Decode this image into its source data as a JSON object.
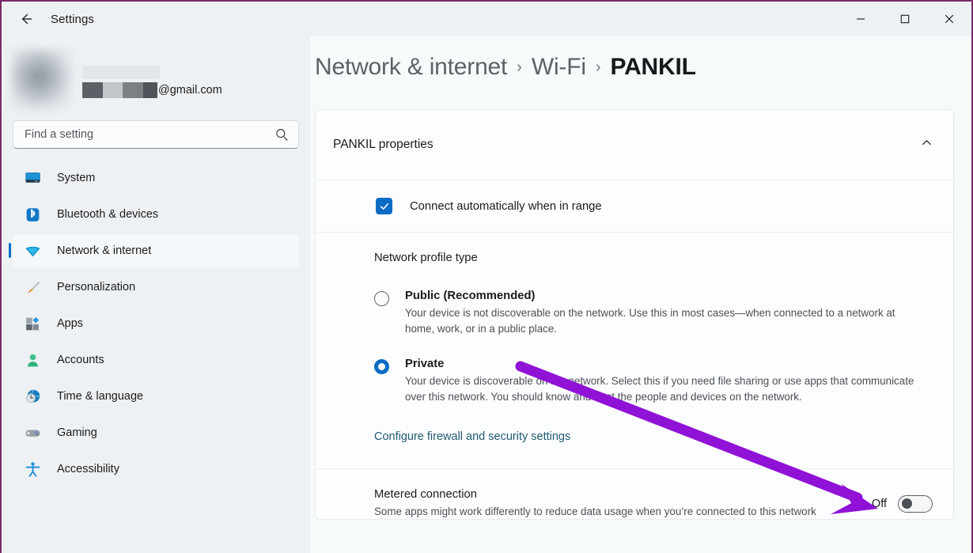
{
  "window": {
    "title": "Settings",
    "back_icon": "back-arrow-icon",
    "minimize_label": "–",
    "maximize_label": "□",
    "close_label": "✕"
  },
  "sidebar": {
    "account": {
      "email_domain": "@gmail.com",
      "name_redacted": true
    },
    "search": {
      "placeholder": "Find a setting",
      "value": "",
      "icon": "search-icon"
    },
    "items": [
      {
        "label": "System",
        "icon": "monitor-icon",
        "selected": false
      },
      {
        "label": "Bluetooth & devices",
        "icon": "bluetooth-icon",
        "selected": false
      },
      {
        "label": "Network & internet",
        "icon": "wifi-icon",
        "selected": true
      },
      {
        "label": "Personalization",
        "icon": "paintbrush-icon",
        "selected": false
      },
      {
        "label": "Apps",
        "icon": "apps-icon",
        "selected": false
      },
      {
        "label": "Accounts",
        "icon": "person-icon",
        "selected": false
      },
      {
        "label": "Time & language",
        "icon": "clock-globe-icon",
        "selected": false
      },
      {
        "label": "Gaming",
        "icon": "gamepad-icon",
        "selected": false
      },
      {
        "label": "Accessibility",
        "icon": "accessibility-icon",
        "selected": false
      }
    ]
  },
  "breadcrumb": {
    "items": [
      "Network & internet",
      "Wi-Fi",
      "PANKIL"
    ],
    "separator": "›"
  },
  "card": {
    "title": "PANKIL properties",
    "collapse_icon": "chevron-up-icon",
    "connect_auto": {
      "label": "Connect automatically when in range",
      "checked": true,
      "icon": "checkmark-icon"
    },
    "profile_type": {
      "section_title": "Network profile type",
      "options": [
        {
          "label": "Public (Recommended)",
          "description": "Your device is not discoverable on the network. Use this in most cases—when connected to a network at home, work, or in a public place.",
          "selected": false
        },
        {
          "label": "Private",
          "description": "Your device is discoverable on the network. Select this if you need file sharing or use apps that communicate over this network. You should know and trust the people and devices on the network.",
          "selected": true
        }
      ]
    },
    "firewall_link": "Configure firewall and security settings",
    "metered": {
      "title": "Metered connection",
      "description": "Some apps might work differently to reduce data usage when you’re connected to this network",
      "state_label": "Off",
      "enabled": false
    }
  },
  "annotation": {
    "arrow_color": "#8f12d6",
    "points_to": "metered-connection-toggle"
  },
  "colors": {
    "accent": "#0a6cc4",
    "link": "#1f5a70",
    "sidebar_bg": "#eef1f4",
    "content_bg": "#f7fafb",
    "card_bg": "#fcfdfe",
    "window_border": "#7a2a6b"
  }
}
